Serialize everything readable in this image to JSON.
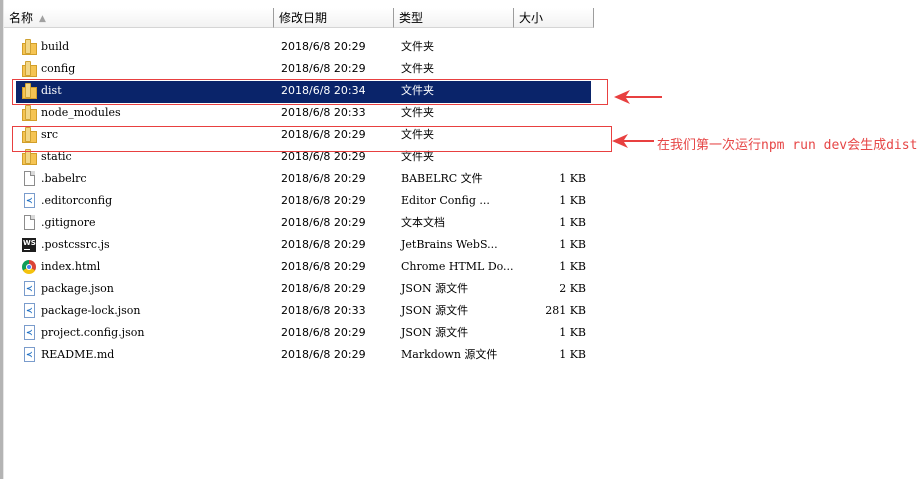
{
  "columns": {
    "name": "名称",
    "date": "修改日期",
    "type": "类型",
    "size": "大小"
  },
  "files": [
    {
      "name": "build",
      "date": "2018/6/8 20:29",
      "type": "文件夹",
      "size": "",
      "icon": "folder-icon"
    },
    {
      "name": "config",
      "date": "2018/6/8 20:29",
      "type": "文件夹",
      "size": "",
      "icon": "folder-icon"
    },
    {
      "name": "dist",
      "date": "2018/6/8 20:34",
      "type": "文件夹",
      "size": "",
      "icon": "folder-icon",
      "selected": true
    },
    {
      "name": "node_modules",
      "date": "2018/6/8 20:33",
      "type": "文件夹",
      "size": "",
      "icon": "folder-icon"
    },
    {
      "name": "src",
      "date": "2018/6/8 20:29",
      "type": "文件夹",
      "size": "",
      "icon": "folder-icon"
    },
    {
      "name": "static",
      "date": "2018/6/8 20:29",
      "type": "文件夹",
      "size": "",
      "icon": "folder-icon"
    },
    {
      "name": ".babelrc",
      "date": "2018/6/8 20:29",
      "type": "BABELRC 文件",
      "size": "1 KB",
      "icon": "file-icon"
    },
    {
      "name": ".editorconfig",
      "date": "2018/6/8 20:29",
      "type": "Editor Config ...",
      "size": "1 KB",
      "icon": "vscode-file-icon"
    },
    {
      "name": ".gitignore",
      "date": "2018/6/8 20:29",
      "type": "文本文档",
      "size": "1 KB",
      "icon": "text-file-icon"
    },
    {
      "name": ".postcssrc.js",
      "date": "2018/6/8 20:29",
      "type": "JetBrains WebS...",
      "size": "1 KB",
      "icon": "webstorm-icon"
    },
    {
      "name": "index.html",
      "date": "2018/6/8 20:29",
      "type": "Chrome HTML Do...",
      "size": "1 KB",
      "icon": "chrome-icon"
    },
    {
      "name": "package.json",
      "date": "2018/6/8 20:29",
      "type": "JSON 源文件",
      "size": "2 KB",
      "icon": "vscode-file-icon"
    },
    {
      "name": "package-lock.json",
      "date": "2018/6/8 20:33",
      "type": "JSON 源文件",
      "size": "281 KB",
      "icon": "vscode-file-icon"
    },
    {
      "name": "project.config.json",
      "date": "2018/6/8 20:29",
      "type": "JSON 源文件",
      "size": "1 KB",
      "icon": "vscode-file-icon"
    },
    {
      "name": "README.md",
      "date": "2018/6/8 20:29",
      "type": "Markdown 源文件",
      "size": "1 KB",
      "icon": "vscode-file-icon"
    }
  ],
  "annotation": {
    "text": "在我们第一次运行npm run dev会生成dist",
    "color": "#e64646"
  },
  "colors": {
    "selection": "#0a246a",
    "highlight_box": "#e84040"
  }
}
